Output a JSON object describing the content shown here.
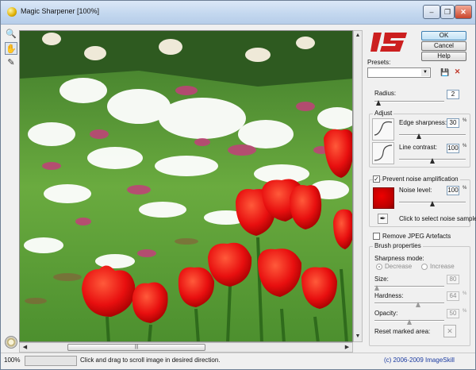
{
  "window": {
    "title": "Magic Sharpener [100%]",
    "minimize_glyph": "–",
    "restore_glyph": "❐",
    "close_glyph": "✕"
  },
  "toolbar": {
    "tools": [
      {
        "icon": "magnifier-icon",
        "glyph": "🔍"
      },
      {
        "icon": "hand-icon",
        "glyph": "✋"
      },
      {
        "icon": "brush-icon",
        "glyph": "✎"
      }
    ]
  },
  "buttons": {
    "ok": "OK",
    "cancel": "Cancel",
    "help": "Help"
  },
  "presets": {
    "label": "Presets:",
    "value": ""
  },
  "radius": {
    "label": "Radius:",
    "value": "2",
    "level": 0.03
  },
  "adjust": {
    "title": "Adjust",
    "edge_sharpness": {
      "label": "Edge sharpness:",
      "value": "30",
      "unit": "%",
      "level": 0.28
    },
    "line_contrast": {
      "label": "Line contrast:",
      "value": "100",
      "unit": "%",
      "level": 0.5
    }
  },
  "noise": {
    "checkbox_label": "Prevent noise amplification",
    "checked": true,
    "noise_level": {
      "label": "Noise level:",
      "value": "100",
      "unit": "%",
      "level": 0.5
    },
    "sample_hint": "Click to select noise sample",
    "swatch_color": "#cc0000"
  },
  "jpeg": {
    "checkbox_label": "Remove JPEG Artefacts",
    "checked": false
  },
  "brush": {
    "title": "Brush properties",
    "mode_label": "Sharpness mode:",
    "modes": [
      "Decrease",
      "Increase"
    ],
    "selected_mode": "Decrease",
    "size": {
      "label": "Size:",
      "value": "80",
      "level": 0.0
    },
    "hardness": {
      "label": "Hardness:",
      "value": "64",
      "unit": "%",
      "level": 0.64
    },
    "opacity": {
      "label": "Opacity:",
      "value": "50",
      "unit": "%",
      "level": 0.5
    },
    "reset_label": "Reset marked area:"
  },
  "scrollbar": {
    "thumb_grip": "|||",
    "left_arrow": "◀",
    "right_arrow": "▶",
    "up_arrow": "▲",
    "down_arrow": "▼"
  },
  "status": {
    "zoom": "100%",
    "hint": "Click and drag to scroll image in desired direction.",
    "copyright": "(c) 2006-2009 ImageSkill"
  },
  "colors": {
    "accent_blue": "#3c7fb1",
    "logo_red": "#cc1f1f",
    "copyright_blue": "#1a3aa0"
  }
}
